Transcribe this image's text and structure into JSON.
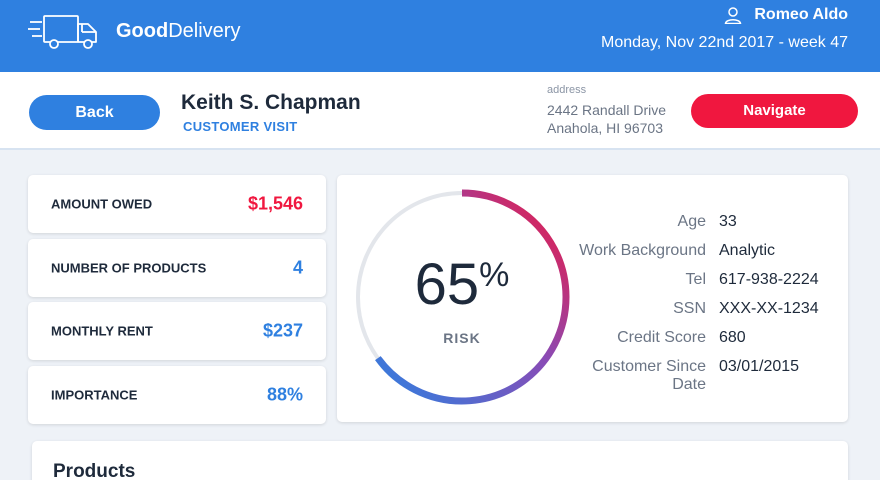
{
  "brand": {
    "name_bold": "Good",
    "name_rest": "Delivery"
  },
  "user": {
    "name": "Romeo Aldo"
  },
  "header": {
    "date": "Monday, Nov 22nd 2017 - week 47"
  },
  "customer": {
    "back_label": "Back",
    "name": "Keith S. Chapman",
    "subtitle": "CUSTOMER VISIT",
    "address_label": "address",
    "address_line1": "2442 Randall Drive",
    "address_line2": "Anahola, HI 96703",
    "navigate_label": "Navigate"
  },
  "stats": [
    {
      "label": "AMOUNT OWED",
      "value": "$1,546",
      "color": "#f0173f"
    },
    {
      "label": "NUMBER OF PRODUCTS",
      "value": "4",
      "color": "#2f80e0"
    },
    {
      "label": "MONTHLY RENT",
      "value": "$237",
      "color": "#2f80e0"
    },
    {
      "label": "IMPORTANCE",
      "value": "88%",
      "color": "#2f80e0"
    }
  ],
  "risk": {
    "percent": 65,
    "percent_text": "65",
    "percent_sign": "%",
    "label": "RISK",
    "gradient_start": "#2f80e0",
    "gradient_end": "#f0173f"
  },
  "details": [
    {
      "key": "Age",
      "value": "33"
    },
    {
      "key": "Work Background",
      "value": "Analytic"
    },
    {
      "key": "Tel",
      "value": "617-938-2224"
    },
    {
      "key": "SSN",
      "value": "XXX-XX-1234"
    },
    {
      "key": "Credit Score",
      "value": "680"
    },
    {
      "key": "Customer Since Date",
      "value": "03/01/2015"
    }
  ],
  "products": {
    "title": "Products"
  },
  "colors": {
    "primary": "#2f80e0",
    "accent": "#f0173f",
    "background": "#eef2f7"
  }
}
